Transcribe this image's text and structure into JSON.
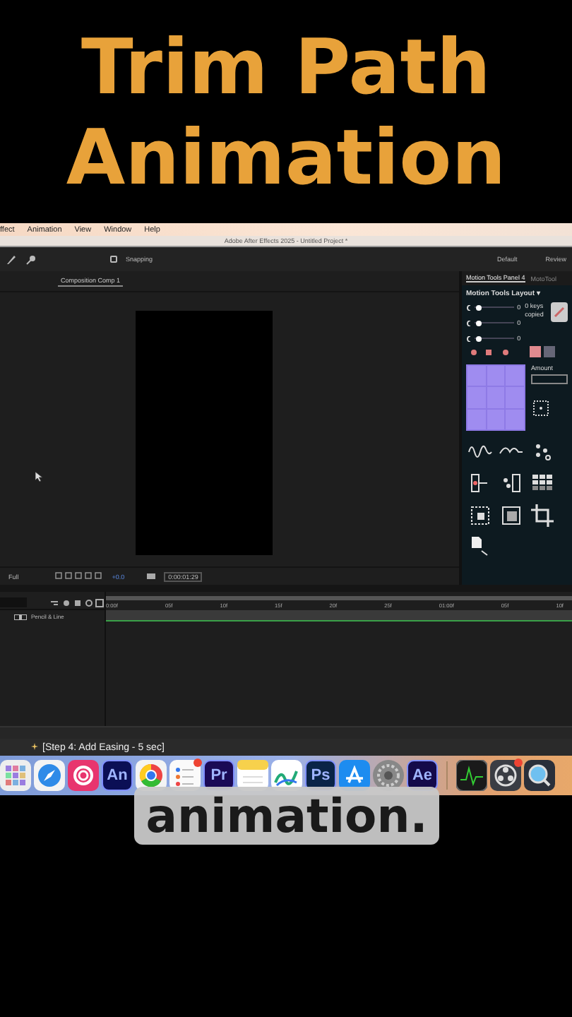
{
  "headline": {
    "lines": [
      "Trim Path",
      "Animation"
    ]
  },
  "menu_bar": {
    "items": [
      "ffect",
      "Animation",
      "View",
      "Window",
      "Help"
    ]
  },
  "app_title": "Adobe After Effects 2025 - Untitled Project *",
  "toolbar": {
    "snapping": {
      "label": "Snapping",
      "checked": false
    },
    "workspaces": [
      "Default",
      "Review"
    ]
  },
  "composition_panel": {
    "tab": "Composition Comp 1",
    "resolution": "Full",
    "exposure": "+0.0",
    "timecode": "0:00:01:29"
  },
  "motion_tools": {
    "tabs": [
      {
        "label": "Motion Tools Panel 4",
        "selected": true
      },
      {
        "label": "MotoTool",
        "selected": false
      }
    ],
    "layout": "Motion Tools Layout",
    "layout_caret": "▾",
    "sliders": [
      {
        "level": 0.1,
        "value": "0"
      },
      {
        "level": 0.1,
        "value": "0"
      },
      {
        "level": 0.1,
        "value": "0"
      }
    ],
    "keys_note": "0 keys copied",
    "amount_label": "Amount"
  },
  "timeline": {
    "ruler": [
      "0:00f",
      "05f",
      "10f",
      "15f",
      "20f",
      "25f",
      "01:00f",
      "05f",
      "10f"
    ],
    "layers": [
      {
        "name": "Pencil & Line"
      }
    ]
  },
  "step_label": "[Step 4: Add Easing - 5 sec]",
  "dock": {
    "apps": [
      {
        "kind": "launchpad",
        "notified": false
      },
      {
        "kind": "safari",
        "notified": false
      },
      {
        "kind": "creative",
        "notified": false
      },
      {
        "kind": "tile",
        "label": "An",
        "color": "#0b0f55",
        "notified": false
      },
      {
        "kind": "chrome",
        "notified": false
      },
      {
        "kind": "reminders",
        "notified": true
      },
      {
        "kind": "tile",
        "label": "Pr",
        "color": "#1a0a55",
        "notified": false
      },
      {
        "kind": "notes",
        "notified": false
      },
      {
        "kind": "freeform",
        "notified": false
      },
      {
        "kind": "tile",
        "label": "Ps",
        "color": "#0a2447",
        "notified": false
      },
      {
        "kind": "appstore",
        "notified": false
      },
      {
        "kind": "settings",
        "notified": false
      },
      {
        "kind": "tile",
        "label": "Ae",
        "color": "#140a4a",
        "notified": false
      },
      {
        "kind": "monitor",
        "notified": false
      },
      {
        "kind": "obs",
        "notified": true
      },
      {
        "kind": "quicktime",
        "notified": false
      }
    ]
  },
  "caption": "animation."
}
